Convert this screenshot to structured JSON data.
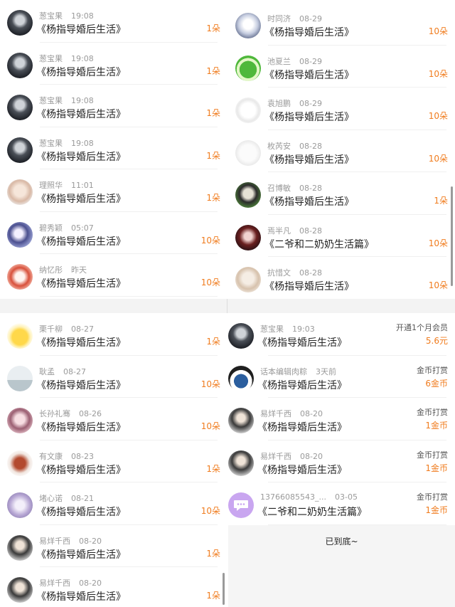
{
  "panels": {
    "tl": {
      "rows": [
        {
          "name": "葱宝果",
          "time": "19:08",
          "title": "《杨指导婚后生活》",
          "amount": "1朵",
          "avatar": "avatar-dark-1"
        },
        {
          "name": "葱宝果",
          "time": "19:08",
          "title": "《杨指导婚后生活》",
          "amount": "1朵",
          "avatar": "avatar-dark-1"
        },
        {
          "name": "葱宝果",
          "time": "19:08",
          "title": "《杨指导婚后生活》",
          "amount": "1朵",
          "avatar": "avatar-dark-1"
        },
        {
          "name": "葱宝果",
          "time": "19:08",
          "title": "《杨指导婚后生活》",
          "amount": "1朵",
          "avatar": "avatar-dark-1"
        },
        {
          "name": "理照华",
          "time": "11:01",
          "title": "《杨指导婚后生活》",
          "amount": "1朵",
          "avatar": "avatar-light-girl"
        },
        {
          "name": "碧秀颖",
          "time": "05:07",
          "title": "《杨指导婚后生活》",
          "amount": "10朵",
          "avatar": "avatar-anime"
        },
        {
          "name": "纳忆彤",
          "time": "昨天",
          "title": "《杨指导婚后生活》",
          "amount": "10朵",
          "avatar": "avatar-red"
        }
      ]
    },
    "tr": {
      "rows": [
        {
          "name": "时同济",
          "time": "08-29",
          "title": "《杨指导婚后生活》",
          "amount": "10朵",
          "avatar": "avatar-pale-anime"
        },
        {
          "name": "池夏兰",
          "time": "08-29",
          "title": "《杨指导婚后生活》",
          "amount": "10朵",
          "avatar": "avatar-frog"
        },
        {
          "name": "袁旭鹏",
          "time": "08-29",
          "title": "《杨指导婚后生活》",
          "amount": "10朵",
          "avatar": "avatar-sketch"
        },
        {
          "name": "枚芮安",
          "time": "08-28",
          "title": "《杨指导婚后生活》",
          "amount": "10朵",
          "avatar": "avatar-white"
        },
        {
          "name": "召博敏",
          "time": "08-28",
          "title": "《杨指导婚后生活》",
          "amount": "1朵",
          "avatar": "avatar-black-cat"
        },
        {
          "name": "焉半凡",
          "time": "08-28",
          "title": "《二爷和二奶奶生活篇》",
          "amount": "10朵",
          "avatar": "avatar-dark-red"
        },
        {
          "name": "抗惜文",
          "time": "08-28",
          "title": "《杨指导婚后生活》",
          "amount": "10朵",
          "avatar": "avatar-beige"
        }
      ]
    },
    "bl": {
      "rows": [
        {
          "name": "栗千柳",
          "time": "08-27",
          "title": "《杨指导婚后生活》",
          "amount": "1朵",
          "avatar": "avatar-yellow-duck"
        },
        {
          "name": "耿孟",
          "time": "08-27",
          "title": "《杨指导婚后生活》",
          "amount": "10朵",
          "avatar": "avatar-grey-sea"
        },
        {
          "name": "长孙礼骞",
          "time": "08-26",
          "title": "《杨指导婚后生活》",
          "amount": "10朵",
          "avatar": "avatar-pink-girl"
        },
        {
          "name": "有文康",
          "time": "08-23",
          "title": "《杨指导婚后生活》",
          "amount": "1朵",
          "avatar": "avatar-red-lion"
        },
        {
          "name": "堵心诺",
          "time": "08-21",
          "title": "《杨指导婚后生活》",
          "amount": "10朵",
          "avatar": "avatar-lavender"
        },
        {
          "name": "易烊千西",
          "time": "08-20",
          "title": "《杨指导婚后生活》",
          "amount": "1朵",
          "avatar": "avatar-boy"
        },
        {
          "name": "易烊千西",
          "time": "08-20",
          "title": "《杨指导婚后生活》",
          "amount": "1朵",
          "avatar": "avatar-boy"
        }
      ]
    },
    "br": {
      "rows": [
        {
          "name": "葱宝果",
          "time": "19:03",
          "title": "《杨指导婚后生活》",
          "type": "开通1个月会员",
          "amount": "5.6元",
          "avatar": "avatar-dark-1"
        },
        {
          "name": "话本编辑肉粽",
          "time": "3天前",
          "title": "《杨指导婚后生活》",
          "type": "金币打赏",
          "amount": "6金币",
          "avatar": "avatar-panda-globe"
        },
        {
          "name": "易烊千西",
          "time": "08-20",
          "title": "《杨指导婚后生活》",
          "type": "金币打赏",
          "amount": "1金币",
          "avatar": "avatar-boy"
        },
        {
          "name": "易烊千西",
          "time": "08-20",
          "title": "《杨指导婚后生活》",
          "type": "金币打赏",
          "amount": "1金币",
          "avatar": "avatar-boy"
        },
        {
          "name": "13766085543_...",
          "time": "03-05",
          "title": "《二爷和二奶奶生活篇》",
          "type": "金币打赏",
          "amount": "1金币",
          "avatar": "avatar-chat-bubble"
        }
      ],
      "end_text": "已到底~"
    }
  },
  "colors": {
    "accent": "#f07c1e",
    "meta": "#9a9a9a",
    "title": "#222222"
  }
}
